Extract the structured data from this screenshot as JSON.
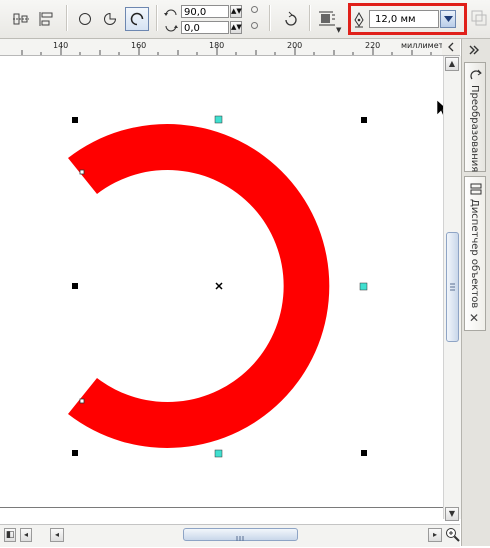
{
  "toolbar": {
    "start_angle": "90,0",
    "end_angle": "0,0",
    "outline_width": "12,0 мм"
  },
  "ruler": {
    "ticks": [
      "140",
      "160",
      "180",
      "200",
      "220"
    ],
    "units_label": "миллиметры"
  },
  "docker": {
    "tab_transform": "Преобразования",
    "tab_object_manager": "Диспетчер объектов"
  },
  "colors": {
    "arc_fill": "#ff0000",
    "highlight": "#e0201a",
    "node_handle": "#40e0d0"
  },
  "icons": {
    "ellipse_tool": "ellipse-icon",
    "pie_tool": "pie-icon",
    "arc_tool": "arc-icon",
    "pen_tool": "pen-icon",
    "close_docker": "close-icon"
  }
}
